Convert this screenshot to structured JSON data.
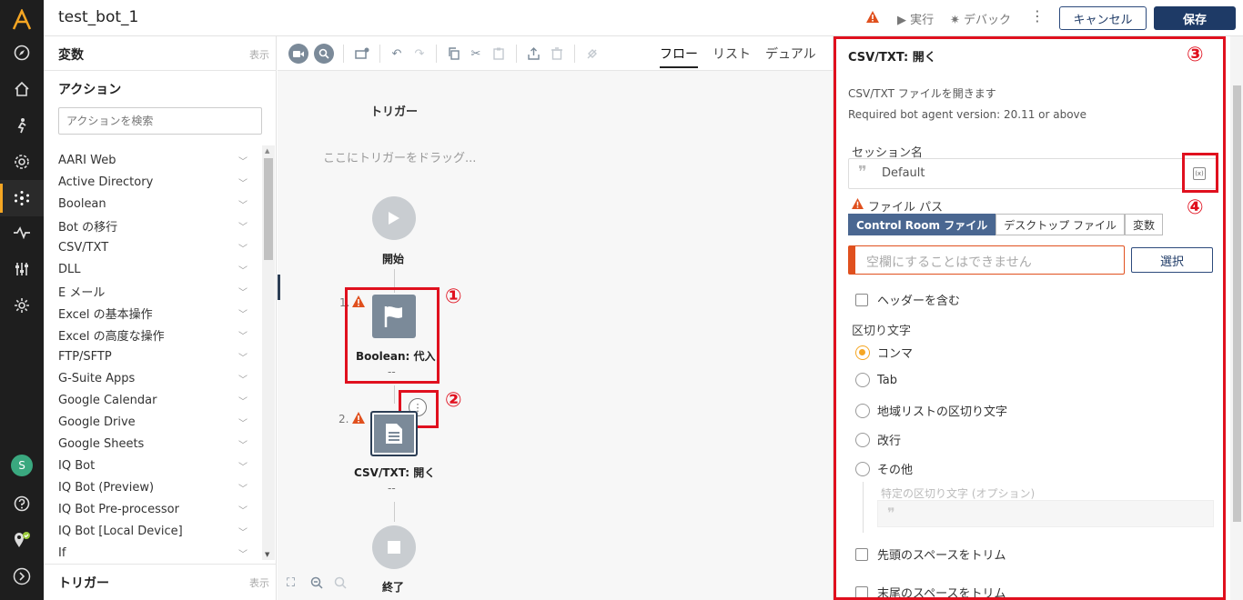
{
  "header": {
    "bot_name": "test_bot_1",
    "run_label": "▶ 実行",
    "debug_label": "✷ デバック",
    "cancel_label": "キャンセル",
    "save_label": "保存"
  },
  "rail": {
    "user_initial": "S"
  },
  "left_panel": {
    "variables_title": "変数",
    "variables_toggle": "表示",
    "actions_title": "アクション",
    "search_placeholder": "アクションを検索",
    "actions": [
      "AARI Web",
      "Active Directory",
      "Boolean",
      "Bot の移行",
      "CSV/TXT",
      "DLL",
      "E メール",
      "Excel の基本操作",
      "Excel の高度な操作",
      "FTP/SFTP",
      "G-Suite Apps",
      "Google Calendar",
      "Google Drive",
      "Google Sheets",
      "IQ Bot",
      "IQ Bot (Preview)",
      "IQ Bot Pre-processor",
      "IQ Bot [Local Device]",
      "If"
    ],
    "triggers_title": "トリガー",
    "triggers_toggle": "表示"
  },
  "canvas": {
    "view_tabs": [
      "フロー",
      "リスト",
      "デュアル"
    ],
    "trigger_title": "トリガー",
    "trigger_drop_hint": "ここにトリガーをドラッグ...",
    "start_label": "開始",
    "step1_num": "1.",
    "step1_label": "Boolean: 代入",
    "step1_dashes": "--",
    "step2_num": "2.",
    "step2_label": "CSV/TXT: 開く",
    "step2_dashes": "--",
    "end_label": "終了",
    "markers": [
      "①",
      "②",
      "③",
      "④"
    ]
  },
  "properties": {
    "title": "CSV/TXT: 開く",
    "description": "CSV/TXT ファイルを開きます",
    "version_note": "Required bot agent version: 20.11 or above",
    "session_label": "セッション名",
    "session_value": "Default",
    "variable_icon": "(x)",
    "file_path_label": "ファイル パス",
    "file_tabs": [
      "Control Room ファイル",
      "デスクトップ ファイル",
      "変数"
    ],
    "file_placeholder": "空欄にすることはできません",
    "select_label": "選択",
    "include_header": "ヘッダーを含む",
    "delimiter_label": "区切り文字",
    "delimiters": [
      "コンマ",
      "Tab",
      "地域リストの区切り文字",
      "改行",
      "その他"
    ],
    "selected_delimiter": "コンマ",
    "custom_delimiter_label": "特定の区切り文字 (オプション)",
    "trim_leading": "先頭のスペースをトリム",
    "trim_trailing": "末尾のスペースをトリム"
  },
  "colors": {
    "accent": "#f5a623",
    "primary": "#1e3a66",
    "warning": "#e0501e",
    "annotation": "#e0101e"
  }
}
